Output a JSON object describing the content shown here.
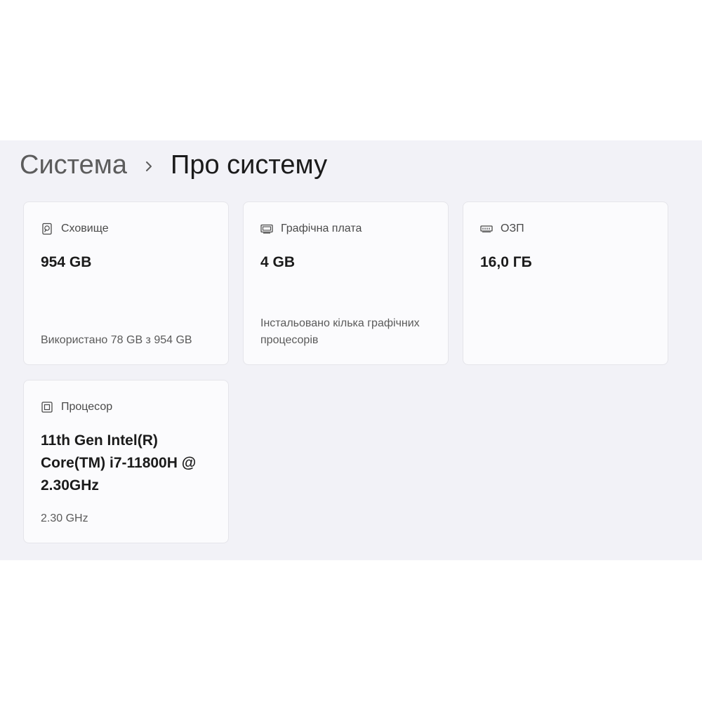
{
  "breadcrumb": {
    "parent": "Система",
    "current": "Про систему"
  },
  "cards": {
    "storage": {
      "icon": "storage-icon",
      "title": "Сховище",
      "value": "954 GB",
      "subtitle": "Використано 78 GB з 954 GB"
    },
    "graphics": {
      "icon": "display-adapter-icon",
      "title": "Графічна плата",
      "value": "4 GB",
      "subtitle": "Інстальовано кілька графічних процесорів"
    },
    "ram": {
      "icon": "memory-icon",
      "title": "ОЗП",
      "value": "16,0 ГБ",
      "subtitle": ""
    },
    "processor": {
      "icon": "processor-icon",
      "title": "Процесор",
      "value": "11th Gen Intel(R) Core(TM) i7-11800H @ 2.30GHz",
      "subtitle": "2.30 GHz"
    }
  }
}
